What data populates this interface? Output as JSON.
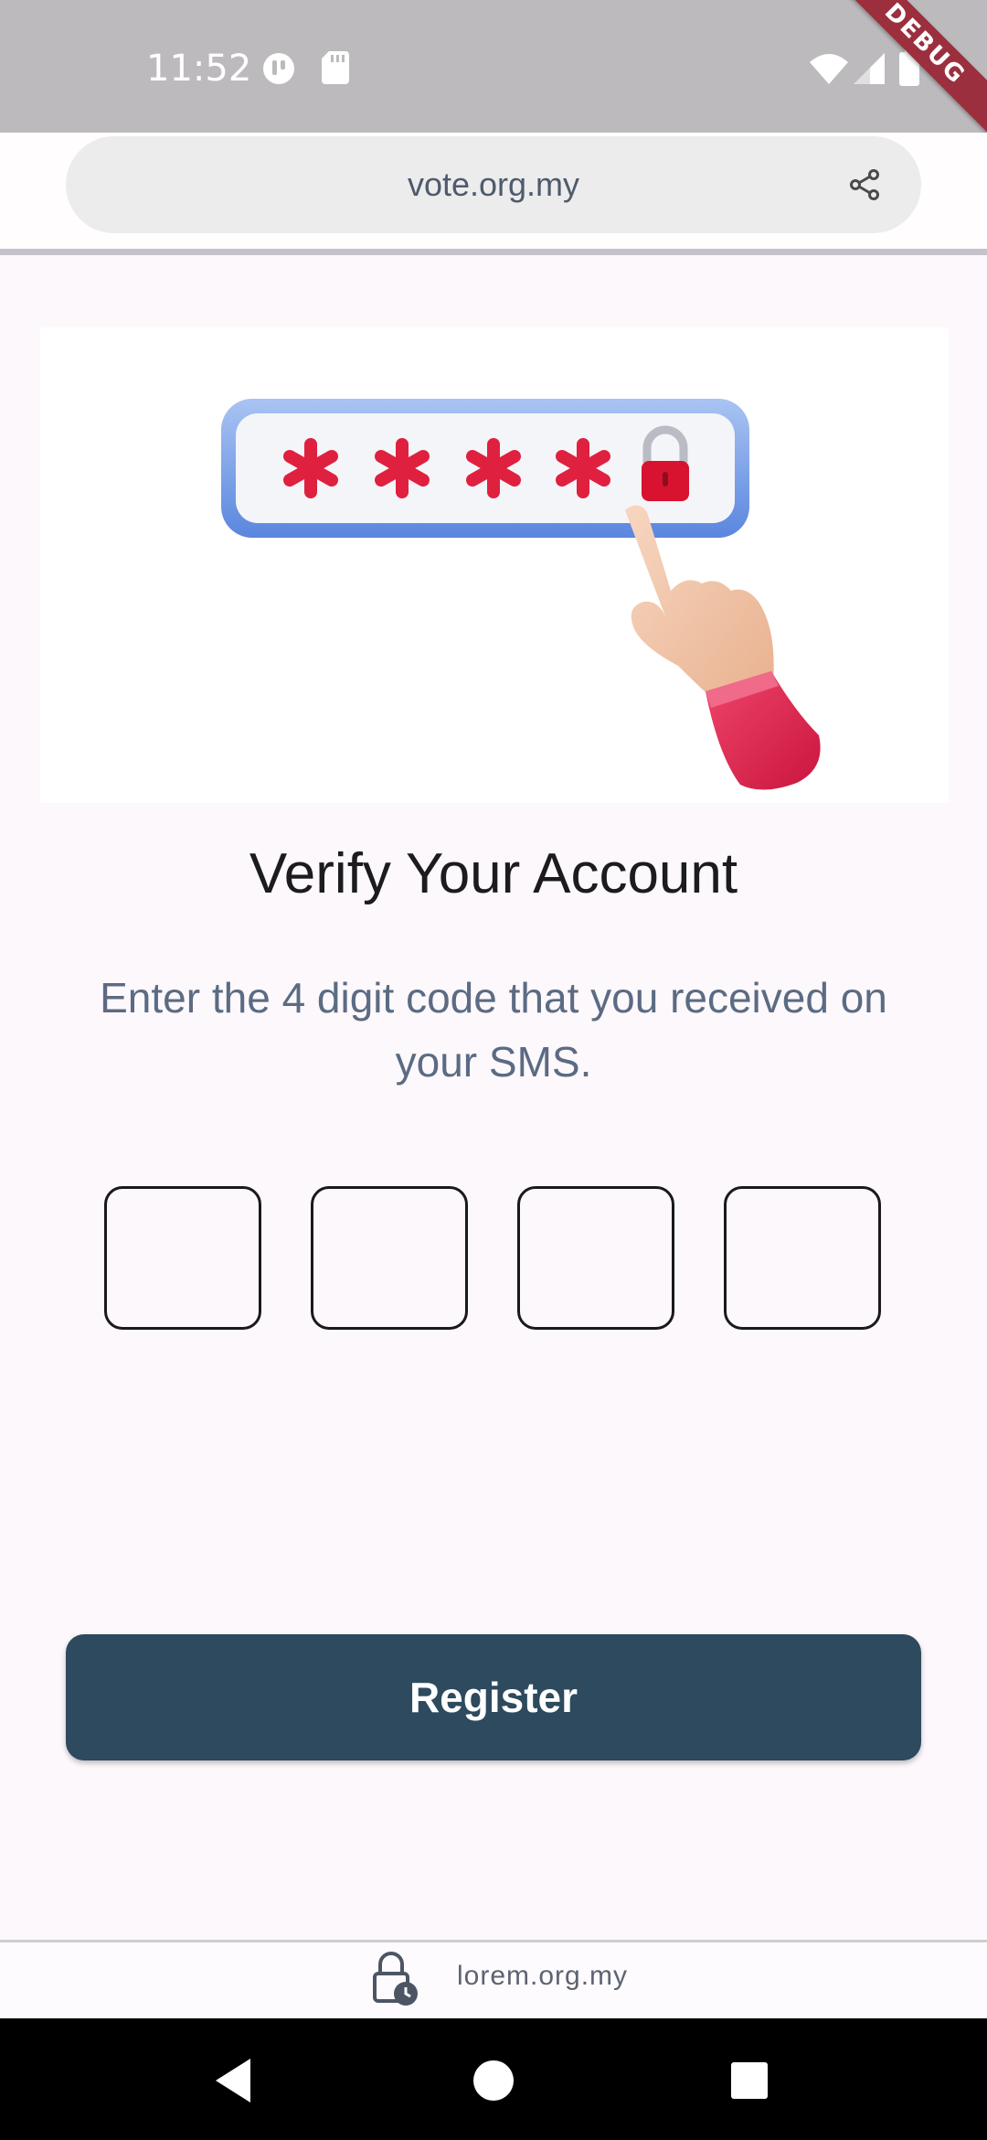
{
  "status_bar": {
    "time": "11:52",
    "debug_label": "DEBUG",
    "icons": [
      "data-saver-icon",
      "sd-card-icon",
      "wifi-icon",
      "signal-icon",
      "battery-icon"
    ]
  },
  "browser": {
    "url": "vote.org.my",
    "share_icon": "share-icon"
  },
  "page": {
    "title": "Verify Your Account",
    "subtitle": "Enter the 4 digit code that you received on your SMS.",
    "otp": {
      "digits": [
        "",
        "",
        "",
        ""
      ]
    },
    "register_label": "Register"
  },
  "footer": {
    "text": "lorem.org.my",
    "icon": "lock-clock-icon"
  },
  "nav": {
    "icons": [
      "back-icon",
      "home-icon",
      "recents-icon"
    ]
  },
  "colors": {
    "background": "#fdf8fb",
    "status_bar": "#bcbabd",
    "button": "#2d4a5e",
    "subtitle": "#5b6b83",
    "password_asterisk": "#e0203f"
  }
}
